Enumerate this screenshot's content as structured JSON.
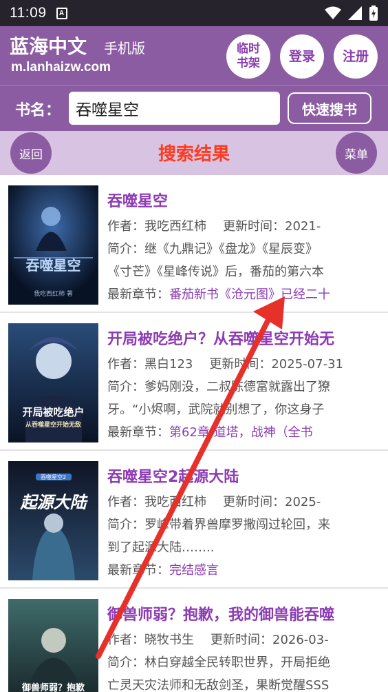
{
  "status_bar": {
    "time": "11:09",
    "badge": "A"
  },
  "header": {
    "site_title": "蓝海中文",
    "site_subtitle": "手机版",
    "site_url": "m.lanhaizw.com",
    "shelf_label": "临时书架",
    "login_label": "登录",
    "register_label": "注册"
  },
  "search": {
    "label": "书名：",
    "value": "吞噬星空",
    "button_label": "快速搜书"
  },
  "titlebar": {
    "back_label": "返回",
    "title": "搜索结果",
    "menu_label": "菜单"
  },
  "labels": {
    "author": "作者：",
    "updated": "更新时间：",
    "intro": "简介：",
    "latest": "最新章节："
  },
  "results": [
    {
      "title": "吞噬星空",
      "author": "我吃西红柿",
      "updated": "2021-",
      "intro1": "继《九鼎记》《盘龙》《星辰变》",
      "intro2": "《寸芒》《星峰传说》后，番茄的第六本",
      "latest": "番茄新书《沧元图》已经二十",
      "cover_title": "吞噬星空",
      "cover_author": "我吃西红柿 著"
    },
    {
      "title": "开局被吃绝户？从吞噬星空开始无",
      "author": "黑白123",
      "updated": "2025-07-31",
      "intro1": "爹妈刚没，二叔陈德富就露出了獠",
      "intro2": "牙。“小烬啊，武院就别想了，你这身子",
      "latest": "第62章 道塔，战神（全书",
      "cover_title": "开局被吃绝户",
      "cover_author": "从吞噬星空开始无敌"
    },
    {
      "title": "吞噬星空2起源大陆",
      "author": "我吃西红柿",
      "updated": "2025-",
      "intro1": "罗峰带着界兽摩罗撒闯过轮回，来",
      "intro2": "到了起源大陆……..",
      "latest": "完结感言",
      "cover_title": "起源大陆",
      "cover_author": "吞噬星空2"
    },
    {
      "title": "御兽师弱？抱歉，我的御兽能吞噬",
      "author": "晓牧书生",
      "updated": "2026-03-",
      "intro1": "林白穿越全民转职世界，开局拒绝",
      "intro2": "亡灵天灾法师和无敌剑圣，果断觉醒SSS",
      "latest": "",
      "cover_title": "御兽师弱？抱歉",
      "cover_author": ""
    }
  ],
  "colors": {
    "header_bg": "#8b5ca2",
    "titlebar_bg": "#d9c3e3",
    "accent_purple": "#8c3bb3",
    "title_red": "#ff3b1f",
    "annotation_arrow": "#e8302a"
  }
}
